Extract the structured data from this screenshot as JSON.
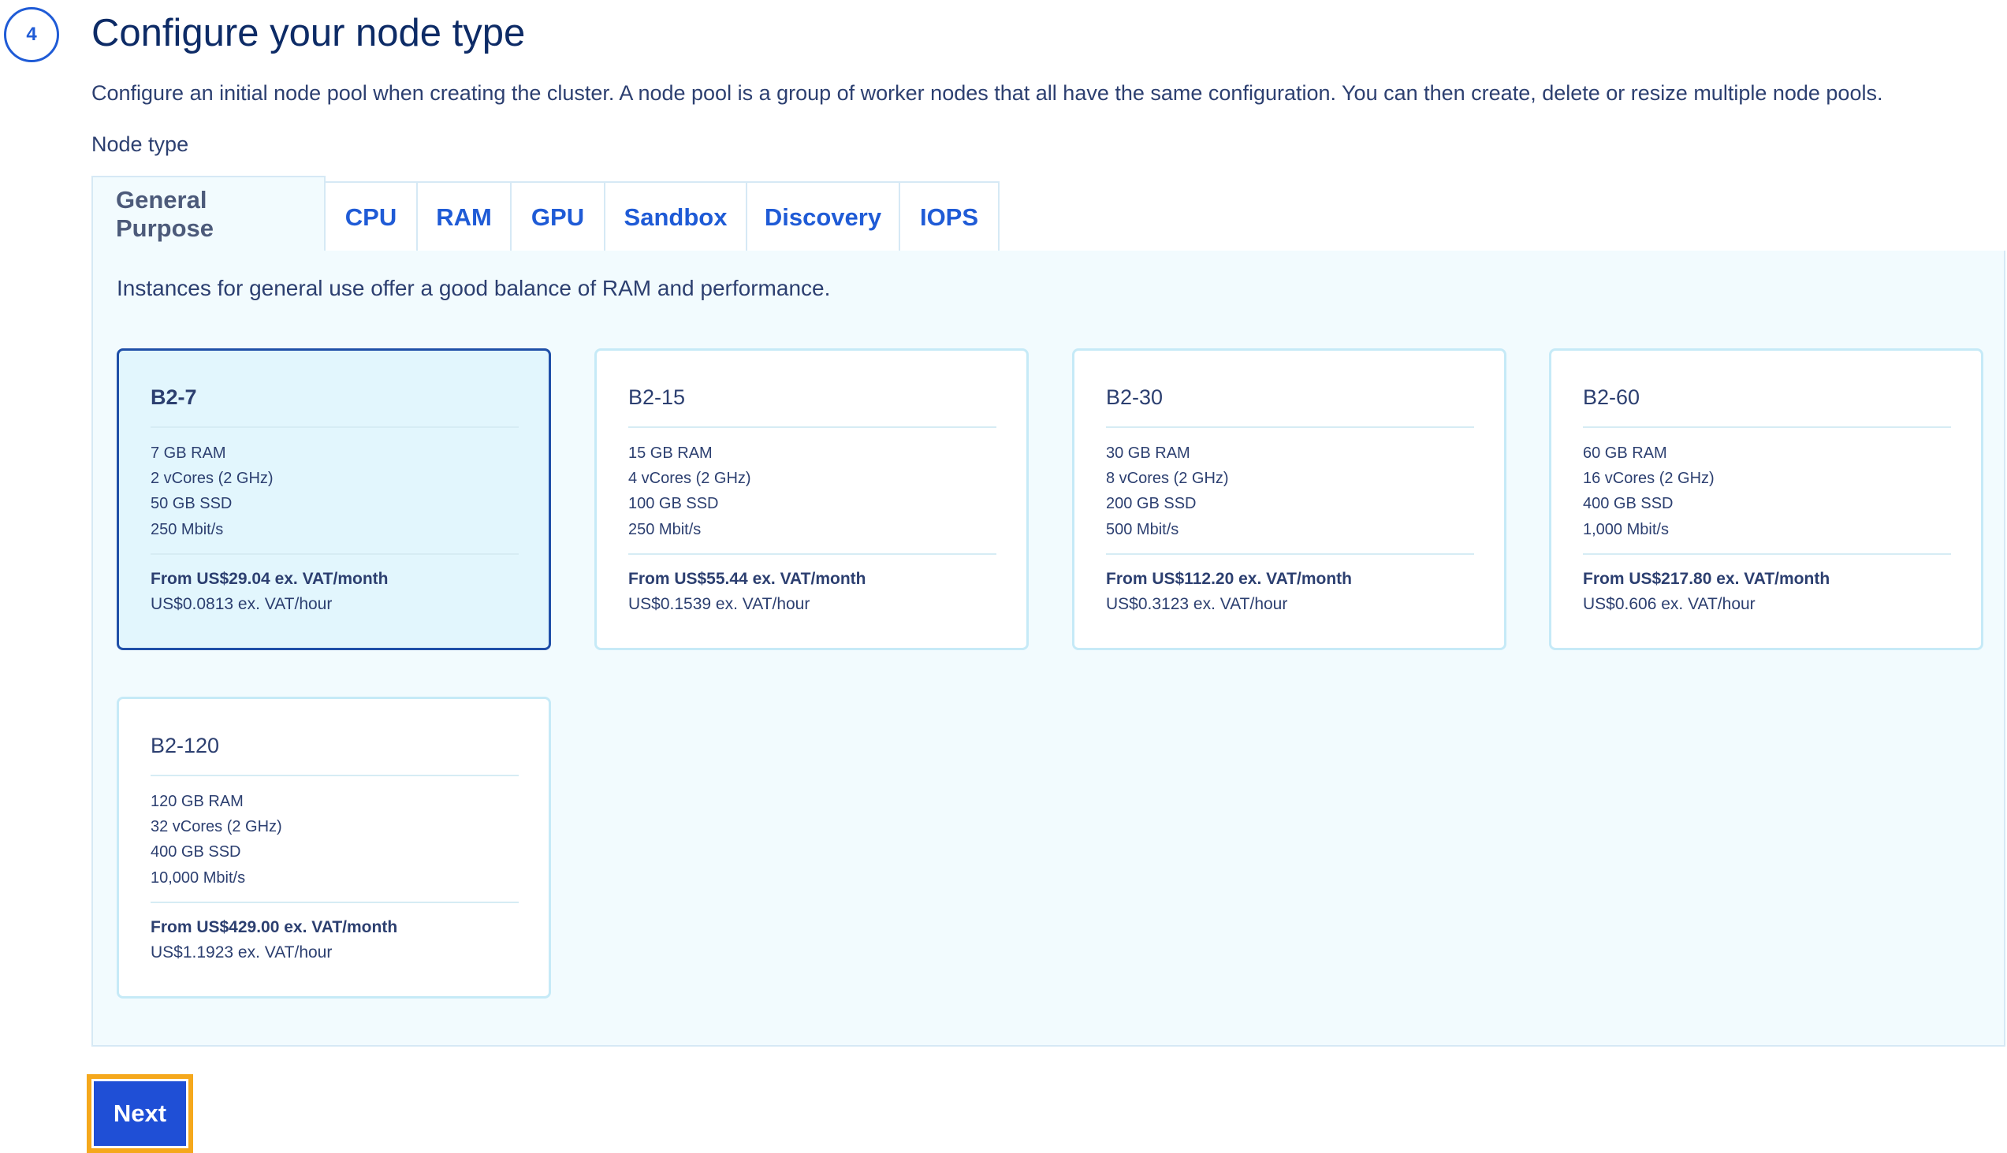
{
  "step": {
    "number": "4",
    "title": "Configure your node type",
    "description": "Configure an initial node pool when creating the cluster. A node pool is a group of worker nodes that all have the same configuration. You can then create, delete or resize multiple node pools."
  },
  "node_type_label": "Node type",
  "tabs": [
    {
      "label": "General Purpose",
      "active": true
    },
    {
      "label": "CPU",
      "active": false
    },
    {
      "label": "RAM",
      "active": false
    },
    {
      "label": "GPU",
      "active": false
    },
    {
      "label": "Sandbox",
      "active": false
    },
    {
      "label": "Discovery",
      "active": false
    },
    {
      "label": "IOPS",
      "active": false
    }
  ],
  "panel_description": "Instances for general use offer a good balance of RAM and performance.",
  "cards": [
    {
      "name": "B2-7",
      "selected": true,
      "specs": [
        "7 GB RAM",
        "2 vCores (2 GHz)",
        "50 GB SSD",
        "250 Mbit/s"
      ],
      "price_month": "From US$29.04 ex. VAT/month",
      "price_hour": "US$0.0813 ex. VAT/hour"
    },
    {
      "name": "B2-15",
      "selected": false,
      "specs": [
        "15 GB RAM",
        "4 vCores (2 GHz)",
        "100 GB SSD",
        "250 Mbit/s"
      ],
      "price_month": "From US$55.44 ex. VAT/month",
      "price_hour": "US$0.1539 ex. VAT/hour"
    },
    {
      "name": "B2-30",
      "selected": false,
      "specs": [
        "30 GB RAM",
        "8 vCores (2 GHz)",
        "200 GB SSD",
        "500 Mbit/s"
      ],
      "price_month": "From US$112.20 ex. VAT/month",
      "price_hour": "US$0.3123 ex. VAT/hour"
    },
    {
      "name": "B2-60",
      "selected": false,
      "specs": [
        "60 GB RAM",
        "16 vCores (2 GHz)",
        "400 GB SSD",
        "1,000 Mbit/s"
      ],
      "price_month": "From US$217.80 ex. VAT/month",
      "price_hour": "US$0.606 ex. VAT/hour"
    },
    {
      "name": "B2-120",
      "selected": false,
      "specs": [
        "120 GB RAM",
        "32 vCores (2 GHz)",
        "400 GB SSD",
        "10,000 Mbit/s"
      ],
      "price_month": "From US$429.00 ex. VAT/month",
      "price_hour": "US$1.1923 ex. VAT/hour"
    }
  ],
  "next_label": "Next"
}
